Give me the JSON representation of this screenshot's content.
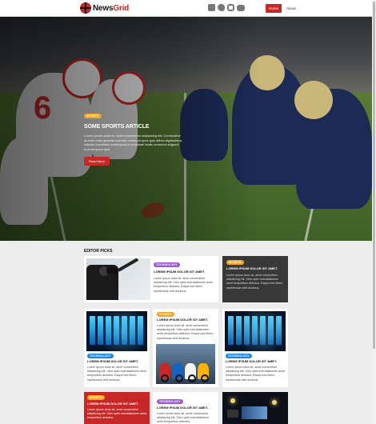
{
  "header": {
    "logo_part1": "News",
    "logo_part2": "Grid",
    "social_icons": [
      "facebook-icon",
      "twitter-icon",
      "instagram-icon",
      "youtube-icon"
    ],
    "nav": [
      {
        "label": "Home",
        "active": true
      },
      {
        "label": "About",
        "active": false
      }
    ],
    "accent_color": "#c62828"
  },
  "hero": {
    "badge": "SPORTS",
    "title": "SOME SPORTS ARTICLE",
    "text": "Lorem ipsum dolor sit, amet consectetur adipisicing elit. Consectetur at enim nulla quaerat sunt iste commodi quos quis officia dignissimos adipisci cupiditate consequuntur molestiae facilis commodi eligendi eum tempora quis.",
    "button": "Read More"
  },
  "editor_picks": {
    "title": "EDITOR PICKS",
    "cards": [
      {
        "badge": "TECHNOLOGY",
        "title": "LOREM IPSUM DOLOR SIT AMET.",
        "text": "Lorem ipsum dolor sit, amet consectetur adipisicing elit. Odio optio exercitationem amet temporibus delectus. Eaque iure libero repellendus velit ducimus."
      },
      {
        "badge": "SPORTS",
        "title": "LOREM IPSUM DOLOR SIT AMET.",
        "text": "Lorem ipsum dolor sit, amet consectetur adipisicing elit. Odio optio exercitationem amet temporibus delectus. Eaque iure libero repellendus velit ducimus."
      },
      {
        "badge": "TECHNOLOGY",
        "title": "LOREM IPSUM DOLOR SIT AMET.",
        "text": "Lorem ipsum dolor sit, amet consectetur adipisicing elit. Odio optio exercitationem amet temporibus delectus. Eaque iure libero repellendus velit ducimus."
      },
      {
        "badge": "SPORTS",
        "title": "LOREM IPSUM DOLOR SIT AMET.",
        "text": "Lorem ipsum dolor sit, amet consectetur adipisicing elit. Odio optio exercitationem amet temporibus delectus. Eaque iure libero repellendus velit ducimus."
      },
      {
        "badge": "TECHNOLOGY",
        "title": "LOREM IPSUM DOLOR SIT AMET.",
        "text": "Lorem ipsum dolor sit, amet consectetur adipisicing elit. Odio optio exercitationem amet temporibus delectus. Eaque iure libero repellendus velit ducimus."
      },
      {
        "badge": "SPORTS",
        "title": "LOREM IPSUM DOLOR SIT AMET.",
        "text": "Lorem ipsum dolor sit, amet consectetur adipisicing elit. Odio optio exercitationem amet temporibus delectus."
      },
      {
        "badge": "TECHNOLOGY",
        "title": "LOREM IPSUM DOLOR SIT AMET.",
        "text": "Lorem ipsum dolor sit, amet consectetur adipisicing elit. Odio optio exercitationem amet temporibus delectus."
      }
    ]
  }
}
